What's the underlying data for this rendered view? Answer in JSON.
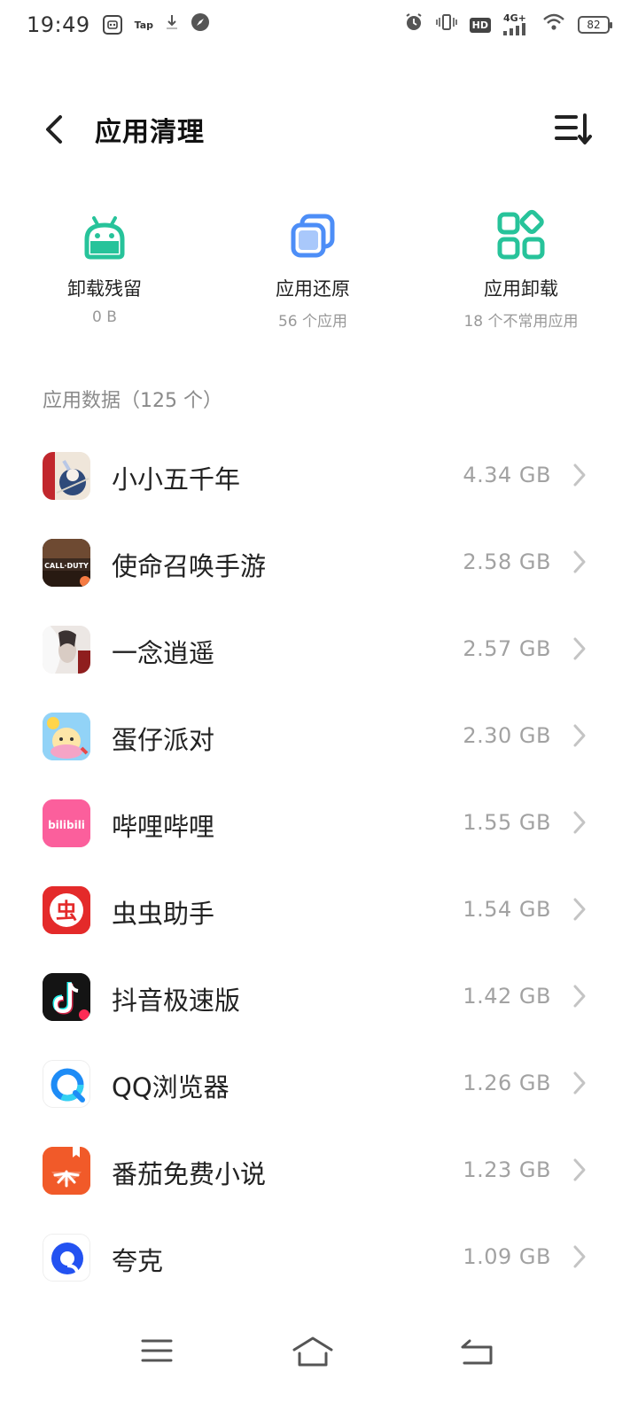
{
  "status": {
    "time": "19:49",
    "tap_label": "Tap",
    "hd_label": "HD",
    "network_label": "4G+",
    "battery_level": "82"
  },
  "header": {
    "title": "应用清理"
  },
  "quick_actions": [
    {
      "label": "卸载残留",
      "sub": "0 B",
      "icon": "android-icon",
      "color": "#27c39a"
    },
    {
      "label": "应用还原",
      "sub": "56 个应用",
      "icon": "layers-icon",
      "color": "#4d8ef7"
    },
    {
      "label": "应用卸载",
      "sub": "18 个不常用应用",
      "icon": "grid-apps-icon",
      "color": "#27c39a"
    }
  ],
  "section": {
    "label": "应用数据（125 个）"
  },
  "apps": [
    {
      "name": "小小五千年",
      "size": "4.34 GB"
    },
    {
      "name": "使命召唤手游",
      "size": "2.58 GB"
    },
    {
      "name": "一念逍遥",
      "size": "2.57 GB"
    },
    {
      "name": "蛋仔派对",
      "size": "2.30 GB"
    },
    {
      "name": "哔哩哔哩",
      "size": "1.55 GB"
    },
    {
      "name": "虫虫助手",
      "size": "1.54 GB"
    },
    {
      "name": "抖音极速版",
      "size": "1.42 GB"
    },
    {
      "name": "QQ浏览器",
      "size": "1.26 GB"
    },
    {
      "name": "番茄免费小说",
      "size": "1.23 GB"
    },
    {
      "name": "夸克",
      "size": "1.09 GB"
    }
  ],
  "icon_text": {
    "bilibili": "bilibili",
    "cod": "CALL·DUTY",
    "chongchong": "虫"
  },
  "colors": {
    "accent_green": "#27c39a",
    "accent_blue": "#4d8ef7",
    "secondary_text": "#a2a2a2"
  }
}
